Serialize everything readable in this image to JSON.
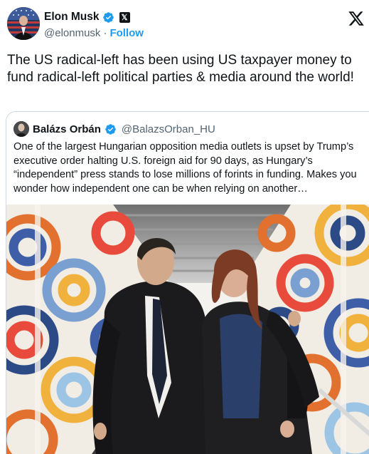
{
  "author": {
    "name": "Elon Musk",
    "handle": "@elonmusk",
    "separator": "·",
    "follow_label": "Follow",
    "affiliate_badge": "𝕏",
    "verified_color": "#1d9bf0"
  },
  "tweet": {
    "text": "The US radical-left has been using US taxpayer money to fund radical-left political parties & media around the world!"
  },
  "quoted": {
    "name": "Balázs Orbán",
    "handle": "@BalazsOrban_HU",
    "text": "One of the largest Hungarian opposition media outlets is upset by Trump’s executive order halting U.S. foreign aid for 90 days, as Hungary’s “independent” press stands to lose millions of forints in funding. Makes you wonder how independent one can be when relying on another…"
  },
  "icons": {
    "close": "x-logo-icon",
    "verified": "verified-badge-icon"
  }
}
